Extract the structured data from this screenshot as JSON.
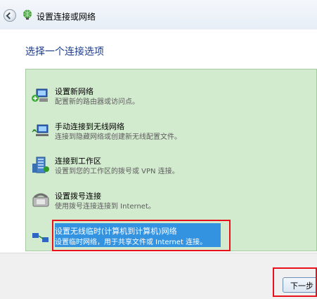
{
  "window": {
    "title": "设置连接或网络"
  },
  "heading": "选择一个连接选项",
  "options": [
    {
      "title": "设置新网络",
      "desc": "配置新的路由器或访问点。",
      "icon": "network-setup-icon"
    },
    {
      "title": "手动连接到无线网络",
      "desc": "连接到隐藏网络或创建新无线配置文件。",
      "icon": "wireless-computer-icon"
    },
    {
      "title": "连接到工作区",
      "desc": "设置到您的工作区的拨号或 VPN 连接。",
      "icon": "workplace-building-icon"
    },
    {
      "title": "设置拨号连接",
      "desc": "使用拨号连接连接到 Internet。",
      "icon": "dialup-phone-icon"
    },
    {
      "title": "设置无线临时(计算机到计算机)网络",
      "desc": "设置临时网络，用于共享文件或 Internet 连接。",
      "icon": "adhoc-network-icon",
      "selected": true
    }
  ],
  "footer": {
    "next_label": "下一步(N)"
  },
  "colors": {
    "selection": "#3393e0",
    "highlight_box": "#e8101a",
    "panel": "#d2eace",
    "heading": "#1b3b8a"
  }
}
